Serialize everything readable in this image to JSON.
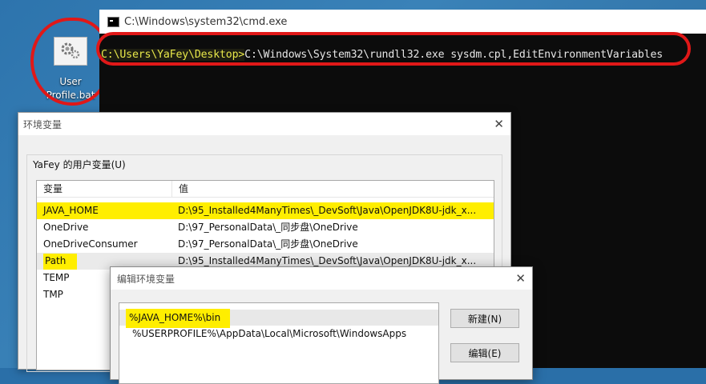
{
  "desktop": {
    "icon_label": "User\nProfile.bat"
  },
  "cmd": {
    "title": "C:\\Windows\\system32\\cmd.exe",
    "prompt_path": "C:\\Users\\YaFey\\Desktop>",
    "command": "C:\\Windows\\System32\\rundll32.exe sysdm.cpl,EditEnvironmentVariables"
  },
  "env_dialog": {
    "title": "环境变量",
    "close": "✕",
    "group_label": "YaFey 的用户变量(U)",
    "columns": [
      "变量",
      "值"
    ],
    "rows": [
      {
        "name": "JAVA_HOME",
        "value": "D:\\95_Installed4ManyTimes\\_DevSoft\\Java\\OpenJDK8U-jdk_x..."
      },
      {
        "name": "OneDrive",
        "value": "D:\\97_PersonalData\\_同步盘\\OneDrive"
      },
      {
        "name": "OneDriveConsumer",
        "value": "D:\\97_PersonalData\\_同步盘\\OneDrive"
      },
      {
        "name": "Path",
        "value": "D:\\95_Installed4ManyTimes\\_DevSoft\\Java\\OpenJDK8U-jdk_x..."
      },
      {
        "name": "TEMP",
        "value": ""
      },
      {
        "name": "TMP",
        "value": ""
      }
    ]
  },
  "edit_dialog": {
    "title": "编辑环境变量",
    "close": "✕",
    "items": [
      "%JAVA_HOME%\\bin",
      "%USERPROFILE%\\AppData\\Local\\Microsoft\\WindowsApps"
    ],
    "new_button": "新建(N)",
    "edit_button": "编辑(E)"
  },
  "colors": {
    "annotation_red": "#e01818",
    "highlight_yellow": "#ffee00",
    "prompt_yellow": "#e8e84a"
  }
}
